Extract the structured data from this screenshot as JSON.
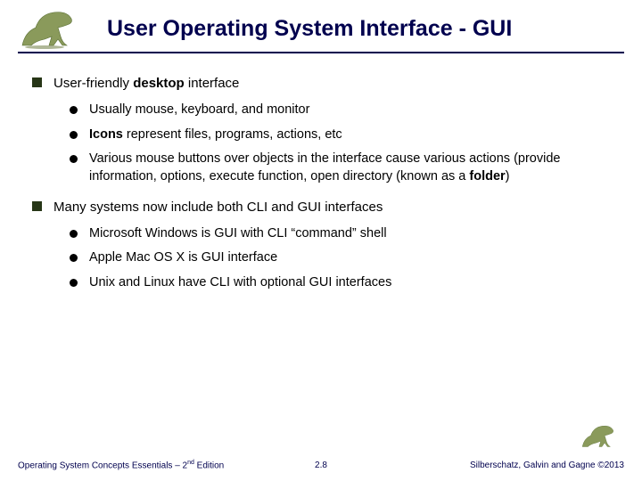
{
  "title": "User Operating System Interface - GUI",
  "bullets": {
    "b1_pre": "User-friendly ",
    "b1_bold": "desktop",
    "b1_post": " interface",
    "b1_1": "Usually mouse, keyboard, and monitor",
    "b1_2_bold": "Icons",
    "b1_2_post": " represent files, programs, actions, etc",
    "b1_3_pre": "Various mouse buttons over objects in the interface cause various actions (provide information, options, execute function, open directory (known as a ",
    "b1_3_bold": "folder",
    "b1_3_post": ")",
    "b2": "Many systems now include both CLI and GUI interfaces",
    "b2_1": "Microsoft Windows is GUI with CLI “command” shell",
    "b2_2": "Apple Mac OS X is GUI interface",
    "b2_3": "Unix and Linux have CLI with optional GUI interfaces"
  },
  "footer": {
    "left_pre": "Operating System Concepts Essentials – 2",
    "left_sup": "nd",
    "left_post": " Edition",
    "center": "2.8",
    "right": "Silberschatz, Galvin and Gagne ©2013"
  }
}
